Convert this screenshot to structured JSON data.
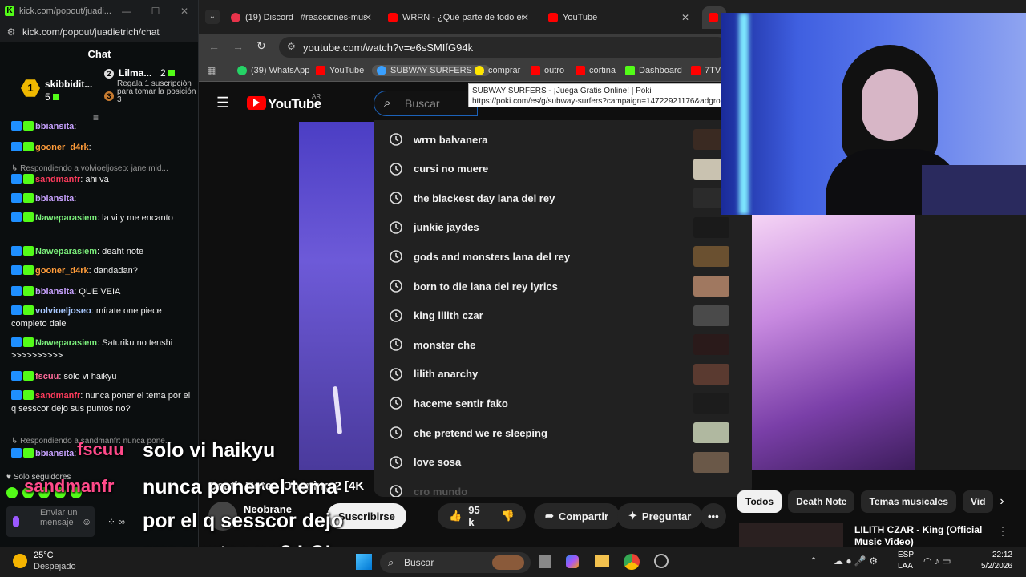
{
  "kick": {
    "window_url_short": "kick.com/popout/juadi...",
    "url": "kick.com/popout/juadietrich/chat",
    "title": "Chat",
    "podium": {
      "first": {
        "rank": "1",
        "name": "skibbidit...",
        "count": "5"
      },
      "second": {
        "rank": "2",
        "name": "Lilma...",
        "count": "2"
      },
      "third": {
        "rank": "3",
        "text": "Regala 1 suscripción para tomar la posición 3"
      }
    },
    "messages": [
      {
        "user": "bbiansita",
        "color": "#c8a2ff",
        "text": ""
      },
      {
        "user": "gooner_d4rk",
        "color": "#ff9c3a",
        "text": ""
      },
      {
        "reply": "Respondiendo a volvioeljoseo: jane mid..."
      },
      {
        "user": "sandmanfr",
        "color": "#ff3b5c",
        "text": "ahi va"
      },
      {
        "user": "bbiansita",
        "color": "#c8a2ff",
        "text": ""
      },
      {
        "user": "Naweparasiem",
        "color": "#7cf07c",
        "text": "la vi y me encanto"
      },
      {
        "user": "Naweparasiem",
        "color": "#7cf07c",
        "text": "deaht note"
      },
      {
        "user": "gooner_d4rk",
        "color": "#ff9c3a",
        "text": "dandadan?"
      },
      {
        "user": "bbiansita",
        "color": "#c8a2ff",
        "text": "QUE VEIA"
      },
      {
        "user": "volvioeljoseo",
        "color": "#a8c8ff",
        "text": "mírate one piece completo dale"
      },
      {
        "user": "Naweparasiem",
        "color": "#7cf07c",
        "text": "Saturiku no tenshi >>>>>>>>>>"
      },
      {
        "user": "fscuu",
        "color": "#ff6b9a",
        "text": "solo vi haikyu"
      },
      {
        "user": "sandmanfr",
        "color": "#ff3b5c",
        "text": "nunca poner el tema por el q sesscor dejo sus puntos no?"
      },
      {
        "reply": "Respondiendo a sandmanfr: nunca pone..."
      },
      {
        "user": "bbiansita",
        "color": "#c8a2ff",
        "text": ""
      }
    ],
    "followers_only": "Solo seguidores",
    "send_placeholder": "Enviar un mensaje",
    "emote_count": "7"
  },
  "browser": {
    "tabs": [
      {
        "label": "(19) Discord | #reacciones-mus",
        "color": "#e8334a"
      },
      {
        "label": "WRRN - ¿Qué parte de todo es",
        "color": "#ff0000"
      },
      {
        "label": "YouTube",
        "color": "#ff0000"
      }
    ],
    "url": "youtube.com/watch?v=e6sSMIfG94k",
    "bookmarks": [
      {
        "label": "(39) WhatsApp",
        "color": "#25d366"
      },
      {
        "label": "YouTube",
        "color": "#ff0000"
      },
      {
        "label": "SUBWAY SURFERS -...",
        "color": "#3aa0ff"
      },
      {
        "label": "comprar",
        "color": "#ffe600"
      },
      {
        "label": "outro",
        "color": "#ff0000"
      },
      {
        "label": "cortina",
        "color": "#ff0000"
      },
      {
        "label": "Dashboard",
        "color": "#53fc18"
      },
      {
        "label": "7TV",
        "color": "#ff0000"
      }
    ],
    "tooltip_title": "SUBWAY SURFERS - ¡Juega Gratis Online! | Poki",
    "tooltip_url": "https://poki.com/es/g/subway-surfers?campaign=14722921176&adgro"
  },
  "youtube": {
    "logo": "YouTube",
    "region": "AR",
    "search_placeholder": "Buscar",
    "suggestions": [
      "wrrn balvanera",
      "cursi no muere",
      "the blackest day lana del rey",
      "junkie jaydes",
      "gods and monsters lana del rey",
      "born to die lana del rey lyrics",
      "king lilith czar",
      "monster che",
      "lilith anarchy",
      "haceme sentir fako",
      "che pretend we re sleeping",
      "love sosa",
      "cro mundo"
    ],
    "video_title": "Death Note - Opening 2 [4K",
    "channel": "Neobrane",
    "subscribe": "Suscribirse",
    "likes": "95 k",
    "share": "Compartir",
    "ask": "Preguntar",
    "chips": [
      "Todos",
      "Death Note",
      "Temas musicales",
      "Vid"
    ],
    "rec_title": "LILITH CZAR - King (Official Music Video)"
  },
  "overlay": {
    "line1_user": "fscuu",
    "line1_text": "solo vi haikyu",
    "line2_user": "sandmanfr",
    "line2_text": "nunca poner el tema",
    "line3_text": "por el q sesscor dejo",
    "line4_text": "sus puntos no? LOL"
  },
  "taskbar": {
    "temp": "25°C",
    "weather": "Despejado",
    "search": "Buscar",
    "lang1": "ESP",
    "lang2": "LAA",
    "time": "22:12",
    "date": "5/2/2026"
  }
}
